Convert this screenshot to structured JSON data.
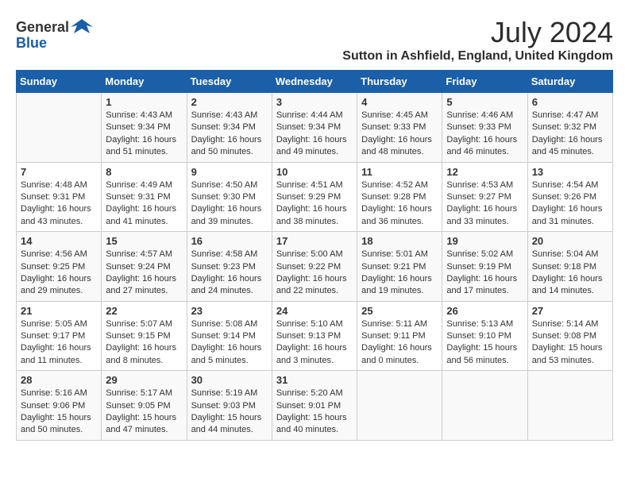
{
  "logo": {
    "text_general": "General",
    "text_blue": "Blue"
  },
  "title": "July 2024",
  "location": "Sutton in Ashfield, England, United Kingdom",
  "headers": [
    "Sunday",
    "Monday",
    "Tuesday",
    "Wednesday",
    "Thursday",
    "Friday",
    "Saturday"
  ],
  "weeks": [
    [
      {
        "day": "",
        "info": ""
      },
      {
        "day": "1",
        "info": "Sunrise: 4:43 AM\nSunset: 9:34 PM\nDaylight: 16 hours\nand 51 minutes."
      },
      {
        "day": "2",
        "info": "Sunrise: 4:43 AM\nSunset: 9:34 PM\nDaylight: 16 hours\nand 50 minutes."
      },
      {
        "day": "3",
        "info": "Sunrise: 4:44 AM\nSunset: 9:34 PM\nDaylight: 16 hours\nand 49 minutes."
      },
      {
        "day": "4",
        "info": "Sunrise: 4:45 AM\nSunset: 9:33 PM\nDaylight: 16 hours\nand 48 minutes."
      },
      {
        "day": "5",
        "info": "Sunrise: 4:46 AM\nSunset: 9:33 PM\nDaylight: 16 hours\nand 46 minutes."
      },
      {
        "day": "6",
        "info": "Sunrise: 4:47 AM\nSunset: 9:32 PM\nDaylight: 16 hours\nand 45 minutes."
      }
    ],
    [
      {
        "day": "7",
        "info": "Sunrise: 4:48 AM\nSunset: 9:31 PM\nDaylight: 16 hours\nand 43 minutes."
      },
      {
        "day": "8",
        "info": "Sunrise: 4:49 AM\nSunset: 9:31 PM\nDaylight: 16 hours\nand 41 minutes."
      },
      {
        "day": "9",
        "info": "Sunrise: 4:50 AM\nSunset: 9:30 PM\nDaylight: 16 hours\nand 39 minutes."
      },
      {
        "day": "10",
        "info": "Sunrise: 4:51 AM\nSunset: 9:29 PM\nDaylight: 16 hours\nand 38 minutes."
      },
      {
        "day": "11",
        "info": "Sunrise: 4:52 AM\nSunset: 9:28 PM\nDaylight: 16 hours\nand 36 minutes."
      },
      {
        "day": "12",
        "info": "Sunrise: 4:53 AM\nSunset: 9:27 PM\nDaylight: 16 hours\nand 33 minutes."
      },
      {
        "day": "13",
        "info": "Sunrise: 4:54 AM\nSunset: 9:26 PM\nDaylight: 16 hours\nand 31 minutes."
      }
    ],
    [
      {
        "day": "14",
        "info": "Sunrise: 4:56 AM\nSunset: 9:25 PM\nDaylight: 16 hours\nand 29 minutes."
      },
      {
        "day": "15",
        "info": "Sunrise: 4:57 AM\nSunset: 9:24 PM\nDaylight: 16 hours\nand 27 minutes."
      },
      {
        "day": "16",
        "info": "Sunrise: 4:58 AM\nSunset: 9:23 PM\nDaylight: 16 hours\nand 24 minutes."
      },
      {
        "day": "17",
        "info": "Sunrise: 5:00 AM\nSunset: 9:22 PM\nDaylight: 16 hours\nand 22 minutes."
      },
      {
        "day": "18",
        "info": "Sunrise: 5:01 AM\nSunset: 9:21 PM\nDaylight: 16 hours\nand 19 minutes."
      },
      {
        "day": "19",
        "info": "Sunrise: 5:02 AM\nSunset: 9:19 PM\nDaylight: 16 hours\nand 17 minutes."
      },
      {
        "day": "20",
        "info": "Sunrise: 5:04 AM\nSunset: 9:18 PM\nDaylight: 16 hours\nand 14 minutes."
      }
    ],
    [
      {
        "day": "21",
        "info": "Sunrise: 5:05 AM\nSunset: 9:17 PM\nDaylight: 16 hours\nand 11 minutes."
      },
      {
        "day": "22",
        "info": "Sunrise: 5:07 AM\nSunset: 9:15 PM\nDaylight: 16 hours\nand 8 minutes."
      },
      {
        "day": "23",
        "info": "Sunrise: 5:08 AM\nSunset: 9:14 PM\nDaylight: 16 hours\nand 5 minutes."
      },
      {
        "day": "24",
        "info": "Sunrise: 5:10 AM\nSunset: 9:13 PM\nDaylight: 16 hours\nand 3 minutes."
      },
      {
        "day": "25",
        "info": "Sunrise: 5:11 AM\nSunset: 9:11 PM\nDaylight: 16 hours\nand 0 minutes."
      },
      {
        "day": "26",
        "info": "Sunrise: 5:13 AM\nSunset: 9:10 PM\nDaylight: 15 hours\nand 56 minutes."
      },
      {
        "day": "27",
        "info": "Sunrise: 5:14 AM\nSunset: 9:08 PM\nDaylight: 15 hours\nand 53 minutes."
      }
    ],
    [
      {
        "day": "28",
        "info": "Sunrise: 5:16 AM\nSunset: 9:06 PM\nDaylight: 15 hours\nand 50 minutes."
      },
      {
        "day": "29",
        "info": "Sunrise: 5:17 AM\nSunset: 9:05 PM\nDaylight: 15 hours\nand 47 minutes."
      },
      {
        "day": "30",
        "info": "Sunrise: 5:19 AM\nSunset: 9:03 PM\nDaylight: 15 hours\nand 44 minutes."
      },
      {
        "day": "31",
        "info": "Sunrise: 5:20 AM\nSunset: 9:01 PM\nDaylight: 15 hours\nand 40 minutes."
      },
      {
        "day": "",
        "info": ""
      },
      {
        "day": "",
        "info": ""
      },
      {
        "day": "",
        "info": ""
      }
    ]
  ]
}
